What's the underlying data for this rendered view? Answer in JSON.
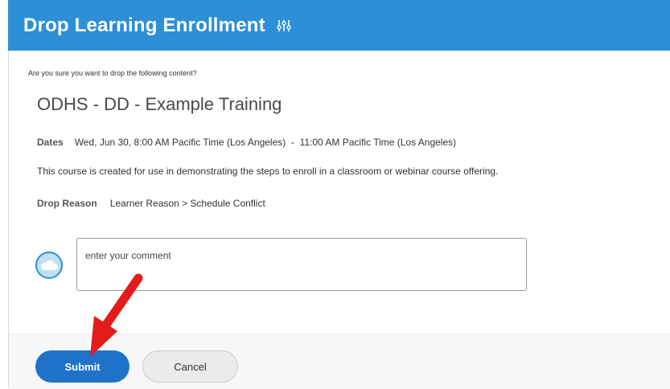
{
  "header": {
    "title": "Drop Learning Enrollment",
    "icon": "related-actions-icon",
    "color": "#2d8fd5"
  },
  "main": {
    "question": "Are you sure you want to drop the following content?",
    "course_title": "ODHS - DD - Example Training",
    "dates_label": "Dates",
    "dates_value": "Wed, Jun 30, 8:00 AM Pacific Time (Los Angeles)  -  11:00 AM Pacific Time (Los Angeles)",
    "description": "This course is created for use in demonstrating the steps to enroll in a classroom or webinar course offering.",
    "drop_reason_label": "Drop Reason",
    "drop_reason_value": "Learner Reason > Schedule Conflict"
  },
  "comment": {
    "placeholder": "enter your comment",
    "value": "",
    "avatar_icon": "cloud-avatar-icon"
  },
  "footer": {
    "submit_label": "Submit",
    "cancel_label": "Cancel",
    "submit_color": "#1f72c9"
  },
  "annotation": {
    "icon": "red-arrow-icon",
    "color": "#e31b1b"
  }
}
